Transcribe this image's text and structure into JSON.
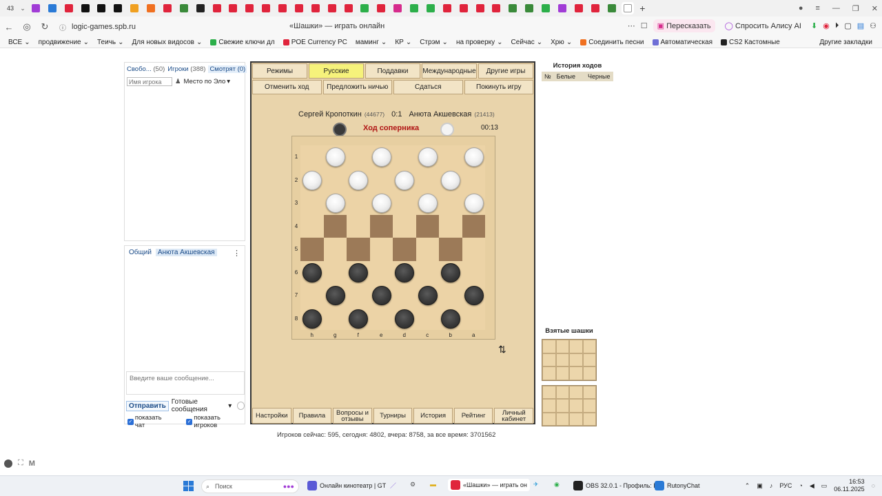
{
  "browser": {
    "tab_count": "43",
    "tab_colors": [
      "#a13cd6",
      "#2a7ad6",
      "#e0243c",
      "#111111",
      "#111111",
      "#111111",
      "#f0a020",
      "#f07020",
      "#e0243c",
      "#3a8a3a",
      "#222222",
      "#e0243c",
      "#e0243c",
      "#e0243c",
      "#e0243c",
      "#e0243c",
      "#e0243c",
      "#e0243c",
      "#e0243c",
      "#e0243c",
      "#2caf4a",
      "#e0243c",
      "#d62b8c",
      "#2caf4a",
      "#2caf4a",
      "#e0243c",
      "#e0243c",
      "#e0243c",
      "#e0243c",
      "#3a8a3a",
      "#3a8a3a",
      "#2caf4a",
      "#a13cd6",
      "#e0243c",
      "#e0243c",
      "#3a8a3a",
      "#ffffff"
    ],
    "url": "logic-games.spb.ru",
    "page_title": "«Шашки» — играть онлайн",
    "retell_label": "Пересказать",
    "alice_label": "Спросить Алису AI",
    "bookmarks": [
      {
        "label": "ВСЕ",
        "color": "#555555"
      },
      {
        "label": "продвижение",
        "color": "#555555"
      },
      {
        "label": "Теичь",
        "color": "#555555"
      },
      {
        "label": "Для новых видосов",
        "color": "#555555"
      },
      {
        "label": "Свежие ключи дл",
        "color": "#2caf4a"
      },
      {
        "label": "POE Currency PC",
        "color": "#e0243c"
      },
      {
        "label": "маминг",
        "color": "#555555"
      },
      {
        "label": "КР",
        "color": "#555555"
      },
      {
        "label": "Стрэм",
        "color": "#555555"
      },
      {
        "label": "на проверку",
        "color": "#555555"
      },
      {
        "label": "Сейчас",
        "color": "#555555"
      },
      {
        "label": "Хрю",
        "color": "#555555"
      },
      {
        "label": "Соединить песни",
        "color": "#f07020"
      },
      {
        "label": "Автоматическая",
        "color": "#6f6fd6"
      },
      {
        "label": "CS2 Кастомные",
        "color": "#222222"
      }
    ],
    "other_bookmarks": "Другие закладки"
  },
  "players_panel": {
    "tab_free": "Свобо...",
    "tab_free_count": "(50)",
    "tab_players": "Игроки",
    "tab_players_count": "(388)",
    "tab_watch": "Смотрят (0)",
    "search_placeholder": "Имя игрока",
    "sort_label": "Место по Эло"
  },
  "chat": {
    "tab_general": "Общий",
    "tab_opponent": "Анюта Акшевская",
    "input_placeholder": "Введите ваше сообщение...",
    "send_label": "Отправить",
    "ready_label": "Готовые сообщения",
    "show_chat": "показать чат",
    "show_players": "показать игроков"
  },
  "game": {
    "modes": [
      "Режимы",
      "Русские",
      "Поддавки",
      "Международные",
      "Другие игры"
    ],
    "selected_mode": "Русские",
    "actions": [
      "Отменить ход",
      "Предложить ничью",
      "Сдаться",
      "Покинуть игру"
    ],
    "player1_name": "Сергей Кропоткин",
    "player1_rating": "(44677)",
    "score": "0:1",
    "player2_name": "Анюта Акшевская",
    "player2_rating": "(21413)",
    "turn_text": "Ход соперника",
    "timer": "00:13",
    "ranks": [
      "1",
      "2",
      "3",
      "4",
      "5",
      "6",
      "7",
      "8"
    ],
    "files": [
      "h",
      "g",
      "f",
      "e",
      "d",
      "c",
      "b",
      "a"
    ],
    "board": [
      [
        "",
        "w",
        "",
        "w",
        "",
        "w",
        "",
        "w"
      ],
      [
        "w",
        "",
        "w",
        "",
        "w",
        "",
        "w",
        ""
      ],
      [
        "",
        "w",
        "",
        "w",
        "",
        "w",
        "",
        "w"
      ],
      [
        "",
        "",
        "",
        "",
        "",
        "",
        "",
        ""
      ],
      [
        "",
        "",
        "",
        "",
        "",
        "",
        "",
        ""
      ],
      [
        "b",
        "",
        "b",
        "",
        "b",
        "",
        "b",
        ""
      ],
      [
        "",
        "b",
        "",
        "b",
        "",
        "b",
        "",
        "b"
      ],
      [
        "b",
        "",
        "b",
        "",
        "b",
        "",
        "b",
        ""
      ]
    ],
    "bottom_nav": [
      "Настройки",
      "Правила",
      "Вопросы и отзывы",
      "Турниры",
      "История",
      "Рейтинг",
      "Личный кабинет"
    ]
  },
  "history": {
    "title": "История ходов",
    "col_num": "№",
    "col_white": "Белые",
    "col_black": "Черные"
  },
  "captured": {
    "title": "Взятые шашки"
  },
  "stats": "Игроков сейчас: 595, сегодня: 4802, вчера: 8758, за все время: 3701562",
  "taskbar": {
    "search_label": "Поиск",
    "items": [
      {
        "label": "Онлайн кинотеатр | GT",
        "color": "#5a5ad6"
      },
      {
        "label": "«Шашки» — играть он",
        "color": "#e0243c"
      },
      {
        "label": "OBS 32.0.1 - Профиль: F",
        "color": "#222222"
      },
      {
        "label": "RutonyChat",
        "color": "#2a7ad6"
      }
    ],
    "lang": "РУС",
    "time": "16:53",
    "date": "06.11.2025"
  }
}
